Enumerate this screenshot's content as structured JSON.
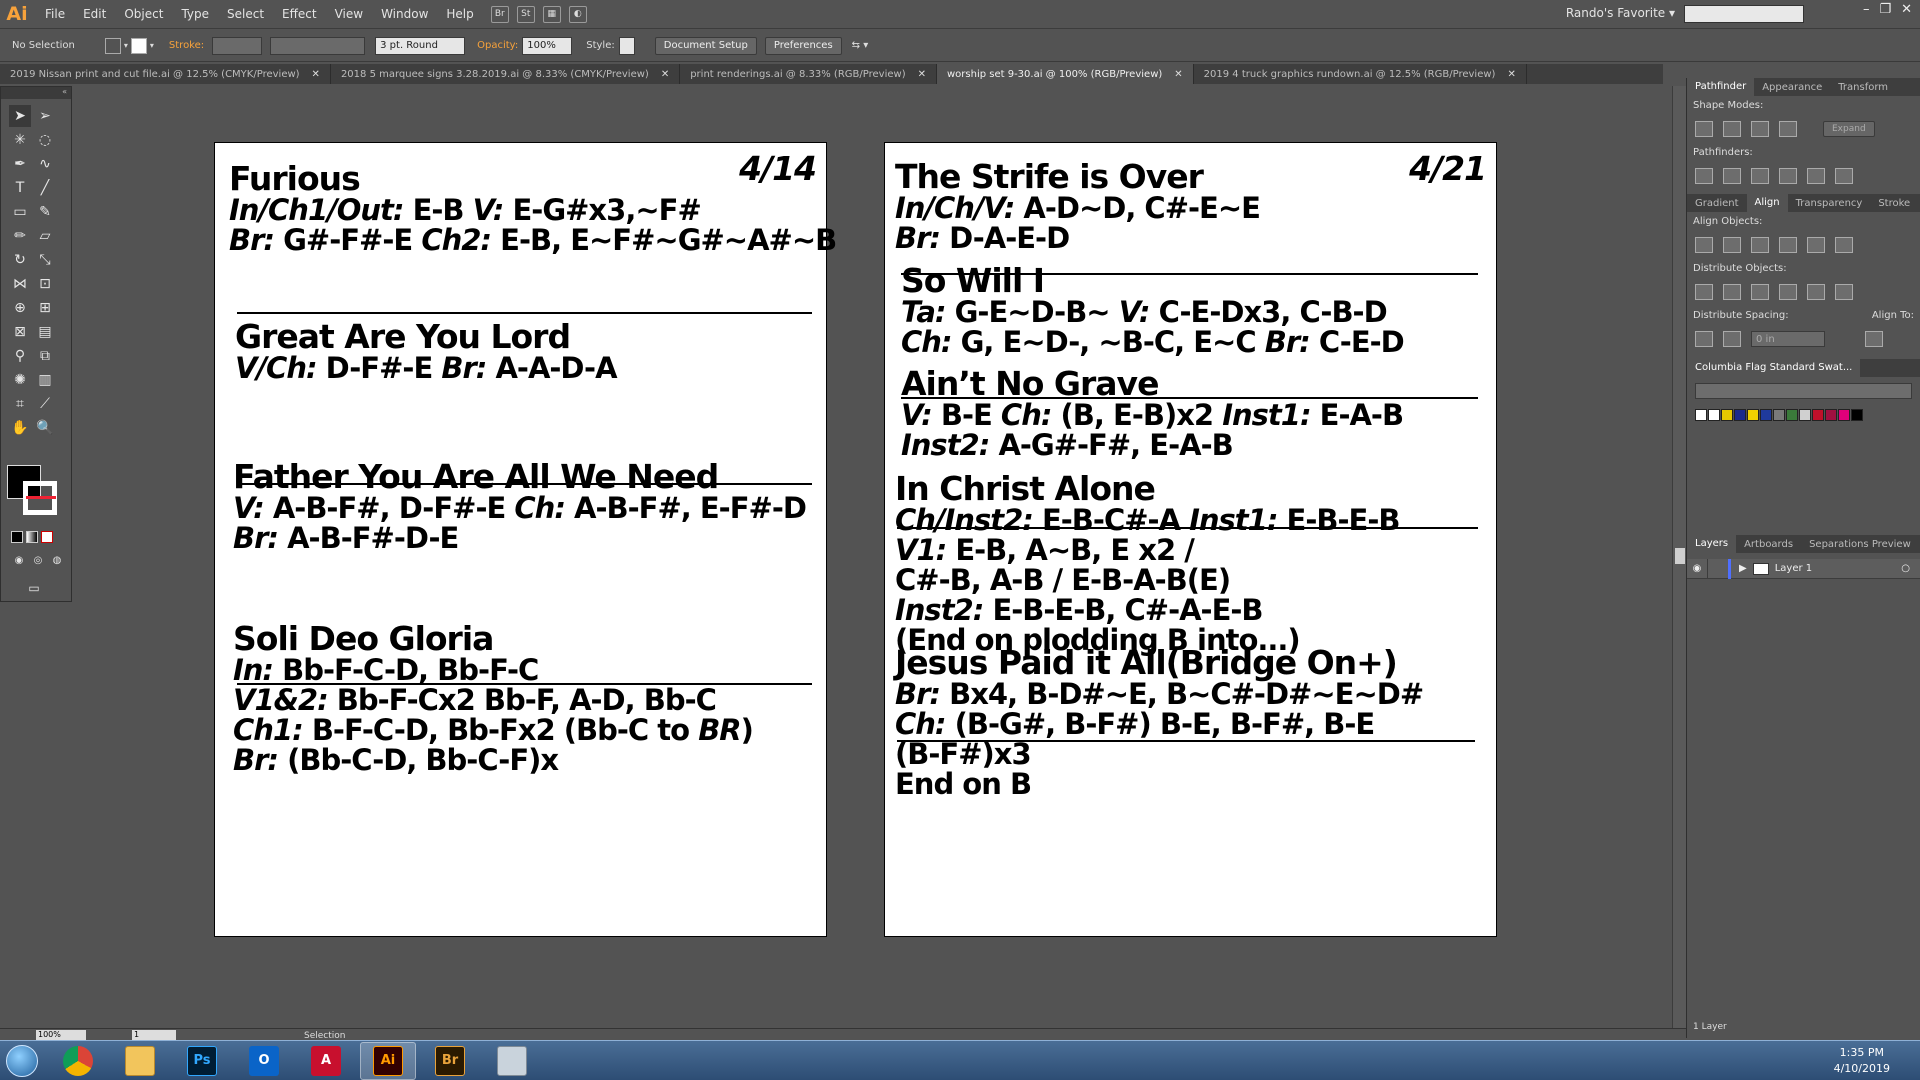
{
  "menubar": {
    "logo": "Ai",
    "items": [
      "File",
      "Edit",
      "Object",
      "Type",
      "Select",
      "Effect",
      "View",
      "Window",
      "Help"
    ],
    "workspace": "Rando's Favorite"
  },
  "control": {
    "selection": "No Selection",
    "stroke_label": "Stroke:",
    "brush": "3 pt. Round",
    "opacity_label": "Opacity:",
    "opacity": "100%",
    "style_label": "Style:",
    "doc_setup": "Document Setup",
    "preferences": "Preferences"
  },
  "tabs": [
    {
      "label": "2019 Nissan print and cut file.ai @ 12.5% (CMYK/Preview)"
    },
    {
      "label": "2018 5 marquee signs 3.28.2019.ai @ 8.33% (CMYK/Preview)"
    },
    {
      "label": "print renderings.ai @ 8.33% (RGB/Preview)"
    },
    {
      "label": "worship set 9-30.ai @ 100% (RGB/Preview)"
    },
    {
      "label": "2019 4 truck graphics rundown.ai @ 12.5% (RGB/Preview)"
    }
  ],
  "artboard1": {
    "date": "4/14",
    "songs": [
      {
        "title": "Furious",
        "lines": [
          [
            {
              "t": "In/Ch1/Out:",
              "i": true
            },
            {
              "t": " E-B   "
            },
            {
              "t": "V:",
              "i": true
            },
            {
              "t": " E-G#x3,~F#"
            }
          ],
          [
            {
              "t": "Br:",
              "i": true
            },
            {
              "t": " G#-F#-E  "
            },
            {
              "t": "Ch2:",
              "i": true
            },
            {
              "t": " E-B, E~F#~G#~A#~B"
            }
          ]
        ]
      },
      {
        "title": "Great Are You Lord",
        "lines": [
          [
            {
              "t": "V/Ch:",
              "i": true
            },
            {
              "t": " D-F#-E  "
            },
            {
              "t": "Br:",
              "i": true
            },
            {
              "t": " A-A-D-A"
            }
          ]
        ]
      },
      {
        "title": "Father You Are All We Need",
        "lines": [
          [
            {
              "t": "V:",
              "i": true
            },
            {
              "t": " A-B-F#, D-F#-E  "
            },
            {
              "t": "Ch:",
              "i": true
            },
            {
              "t": " A-B-F#, E-F#-D"
            }
          ],
          [
            {
              "t": "Br:",
              "i": true
            },
            {
              "t": " A-B-F#-D-E"
            }
          ]
        ]
      },
      {
        "title": "Soli Deo Gloria",
        "lines": [
          [
            {
              "t": "In:",
              "i": true
            },
            {
              "t": " Bb-F-C-D, Bb-F-C"
            }
          ],
          [
            {
              "t": "V1&2:",
              "i": true
            },
            {
              "t": " Bb-F-Cx2 Bb-F, A-D, Bb-C"
            }
          ],
          [
            {
              "t": "Ch1:",
              "i": true
            },
            {
              "t": " B-F-C-D, Bb-Fx2 (Bb-C to "
            },
            {
              "t": "BR",
              "i": true
            },
            {
              "t": ")"
            }
          ],
          [
            {
              "t": "Br:",
              "i": true
            },
            {
              "t": " (Bb-C-D, Bb-C-F)x"
            }
          ]
        ]
      }
    ]
  },
  "artboard2": {
    "date": "4/21",
    "songs": [
      {
        "title": "The Strife is Over",
        "lines": [
          [
            {
              "t": "In/Ch/V:",
              "i": true
            },
            {
              "t": " A-D~D, C#-E~E"
            }
          ],
          [
            {
              "t": "Br:",
              "i": true
            },
            {
              "t": " D-A-E-D"
            }
          ]
        ]
      },
      {
        "title": "So Will I",
        "lines": [
          [
            {
              "t": "Ta:",
              "i": true
            },
            {
              "t": "  G-E~D-B~  "
            },
            {
              "t": "V:",
              "i": true
            },
            {
              "t": "  C-E-Dx3, C-B-D"
            }
          ],
          [
            {
              "t": "Ch:",
              "i": true
            },
            {
              "t": " G, E~D-, ~B-C, E~C  "
            },
            {
              "t": "Br:",
              "i": true
            },
            {
              "t": " C-E-D"
            }
          ]
        ]
      },
      {
        "title": "Ain’t No Grave",
        "lines": [
          [
            {
              "t": "V:",
              "i": true
            },
            {
              "t": " B-E    "
            },
            {
              "t": "Ch:",
              "i": true
            },
            {
              "t": " (B, E-B)x2   "
            },
            {
              "t": "Inst1:",
              "i": true
            },
            {
              "t": " E-A-B"
            }
          ],
          [
            {
              "t": "Inst2:",
              "i": true
            },
            {
              "t": " A-G#-F#, E-A-B"
            }
          ]
        ]
      },
      {
        "title": "In Christ Alone",
        "lines": [
          [
            {
              "t": "Ch/Inst2:",
              "i": true
            },
            {
              "t": " E-B-C#-A    "
            },
            {
              "t": "Inst1:",
              "i": true
            },
            {
              "t": " E-B-E-B"
            }
          ],
          [
            {
              "t": "V1:",
              "i": true
            },
            {
              "t": " E-B, A~B, E x2 /"
            }
          ],
          [
            {
              "t": "C#-B, A-B / E-B-A-B(E)"
            }
          ],
          [
            {
              "t": "Inst2:",
              "i": true
            },
            {
              "t": " E-B-E-B, C#-A-E-B"
            }
          ],
          [
            {
              "t": "(End on plodding B into...)"
            }
          ]
        ]
      },
      {
        "title": "Jesus Paid it All(Bridge On+)",
        "lines": [
          [
            {
              "t": "Br:",
              "i": true
            },
            {
              "t": " Bx4,    B-D#~E, B~C#-D#~E~D#"
            }
          ],
          [
            {
              "t": "Ch:",
              "i": true
            },
            {
              "t": " (B-G#, B-F#) B-E, B-F#, B-E"
            }
          ],
          [
            {
              "t": "        (B-F#)x3"
            }
          ],
          [
            {
              "t": "End on B"
            }
          ]
        ]
      }
    ]
  },
  "rpanel": {
    "tabs1": [
      "Pathfinder",
      "Appearance",
      "Transform"
    ],
    "shape_modes": "Shape Modes:",
    "expand": "Expand",
    "pathfinders": "Pathfinders:",
    "tabs2": [
      "Gradient",
      "Align",
      "Transparency",
      "Stroke"
    ],
    "align_objects": "Align Objects:",
    "distribute_objects": "Distribute Objects:",
    "distribute_spacing": "Distribute Spacing:",
    "align_to": "Align To:",
    "spacing_value": "0 in",
    "swatch_lib": "Columbia Flag Standard Swat...",
    "swatches": [
      "#ffffff",
      "#ffffff",
      "#e6c800",
      "#1a2a8c",
      "#f0d000",
      "#1f3a9c",
      "#7a7a7a",
      "#3a7a3a",
      "#d0d0d0",
      "#c0102a",
      "#a01040",
      "#e0007a",
      "#000000"
    ],
    "tabs3": [
      "Layers",
      "Artboards",
      "Separations Preview"
    ],
    "layer_name": "Layer 1",
    "layer_count": "1 Layer"
  },
  "status": {
    "zoom": "100%",
    "page": "1",
    "mode": "Selection"
  },
  "taskbar": {
    "apps": [
      "chrome",
      "explorer",
      "Ps",
      "outlook",
      "acrobat",
      "Ai",
      "Br",
      "calculator"
    ],
    "time": "1:35 PM",
    "date": "4/10/2019"
  }
}
